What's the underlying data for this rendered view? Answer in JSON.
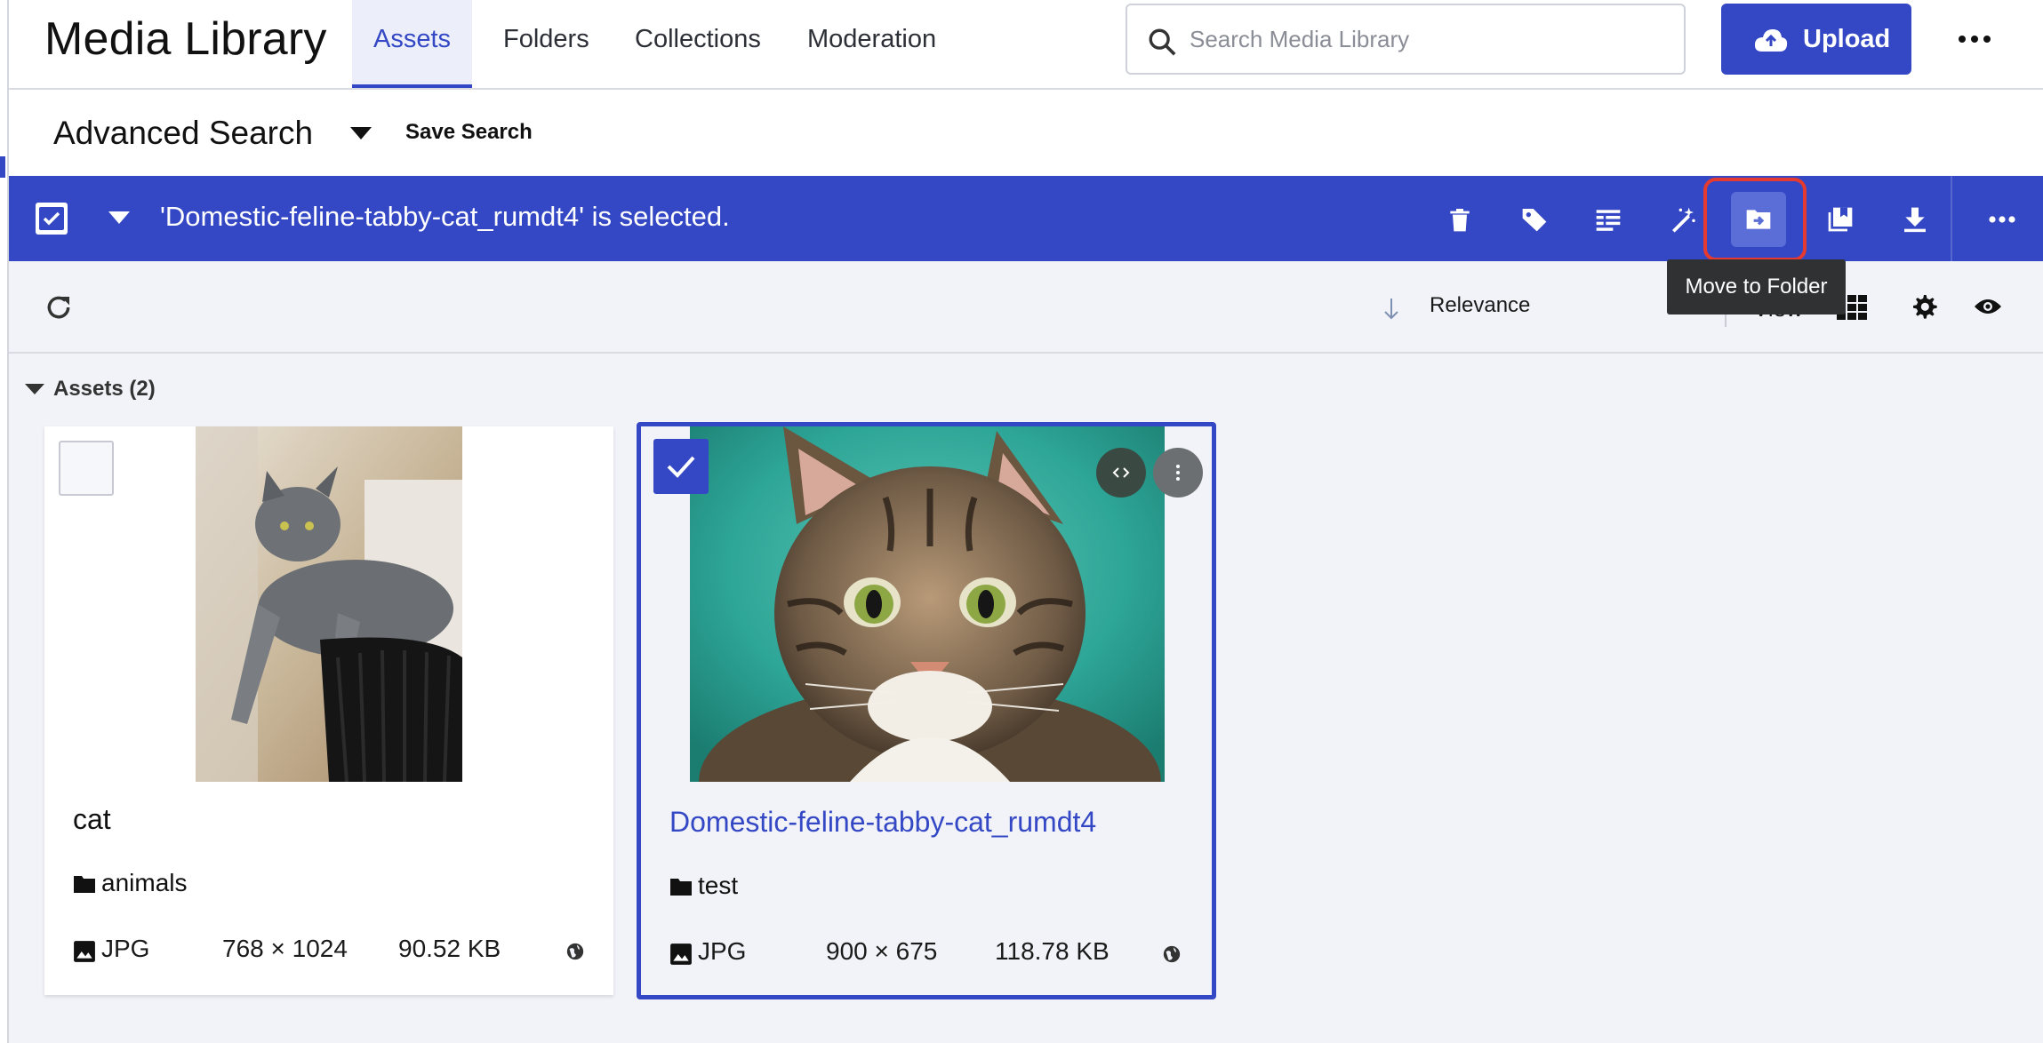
{
  "app": {
    "title": "Media Library"
  },
  "nav": {
    "tabs": [
      {
        "label": "Assets",
        "active": true
      },
      {
        "label": "Folders",
        "active": false
      },
      {
        "label": "Collections",
        "active": false
      },
      {
        "label": "Moderation",
        "active": false
      }
    ]
  },
  "search": {
    "placeholder": "Search Media Library",
    "value": ""
  },
  "header": {
    "upload_label": "Upload",
    "more_icon": "more-horizontal-icon"
  },
  "advanced_search": {
    "title": "Advanced Search",
    "save_label": "Save Search"
  },
  "selection_bar": {
    "text": "'Domestic-feline-tabby-cat_rumdt4' is selected.",
    "tools": [
      "delete-icon",
      "tag-icon",
      "metadata-icon",
      "magic-wand-icon",
      "move-to-folder-icon",
      "add-to-collection-icon",
      "download-icon",
      "more-horizontal-icon"
    ],
    "tooltip": "Move to Folder"
  },
  "sort": {
    "label": "Relevance",
    "view_label": "View"
  },
  "assets": {
    "header": "Assets (2)",
    "items": [
      {
        "name": "cat",
        "folder": "animals",
        "format": "JPG",
        "dimensions": "768 × 1024",
        "size": "90.52 KB",
        "selected": false
      },
      {
        "name": "Domestic-feline-tabby-cat_rumdt4",
        "folder": "test",
        "format": "JPG",
        "dimensions": "900 × 675",
        "size": "118.78 KB",
        "selected": true
      }
    ]
  },
  "colors": {
    "accent": "#3448c5",
    "highlight_ring": "#e43a2f",
    "tooltip_bg": "#2f3133"
  }
}
